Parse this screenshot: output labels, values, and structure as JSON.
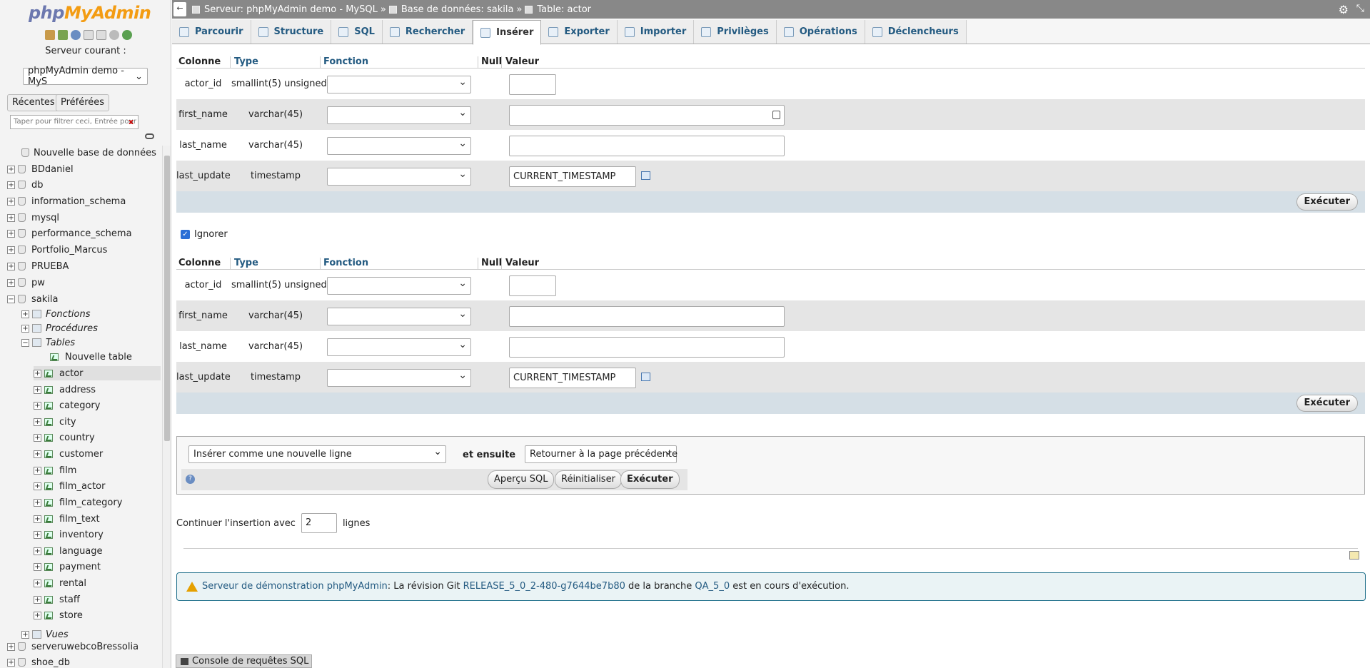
{
  "nav": {
    "logo_php": "php",
    "logo_myadmin": "MyAdmin",
    "server_label": "Serveur courant :",
    "server_select": "phpMyAdmin demo - MyS",
    "recent": "Récentes",
    "favorites": "Préférées",
    "filter_placeholder": "Taper pour filtrer ceci, Entrée pour tout",
    "filter_clear": "x",
    "new_database": "Nouvelle base de données",
    "databases": [
      "BDdaniel",
      "db",
      "information_schema",
      "mysql",
      "performance_schema",
      "Portfolio_Marcus",
      "PRUEBA",
      "pw",
      "sakila"
    ],
    "sakila_groups": {
      "functions": "Fonctions",
      "procedures": "Procédures",
      "tables": "Tables",
      "views": "Vues"
    },
    "new_table": "Nouvelle table",
    "tables": [
      "actor",
      "address",
      "category",
      "city",
      "country",
      "customer",
      "film",
      "film_actor",
      "film_category",
      "film_text",
      "inventory",
      "language",
      "payment",
      "rental",
      "staff",
      "store"
    ],
    "more_databases": [
      "serveruwebcoBressolia",
      "shoe_db"
    ]
  },
  "topbar": {
    "back": "←",
    "server": "Serveur: phpMyAdmin demo - MySQL",
    "sep1": "»",
    "database": "Base de données: sakila",
    "sep2": "»",
    "table": "Table: actor"
  },
  "tabs": [
    {
      "label": "Parcourir"
    },
    {
      "label": "Structure"
    },
    {
      "label": "SQL"
    },
    {
      "label": "Rechercher"
    },
    {
      "label": "Insérer"
    },
    {
      "label": "Exporter"
    },
    {
      "label": "Importer"
    },
    {
      "label": "Privilèges"
    },
    {
      "label": "Opérations"
    },
    {
      "label": "Déclencheurs"
    }
  ],
  "insert": {
    "headers": {
      "column": "Colonne",
      "type": "Type",
      "function": "Fonction",
      "null": "Null",
      "value": "Valeur"
    },
    "rows": [
      {
        "column": "actor_id",
        "type": "smallint(5) unsigned",
        "value": ""
      },
      {
        "column": "first_name",
        "type": "varchar(45)",
        "value": ""
      },
      {
        "column": "last_name",
        "type": "varchar(45)",
        "value": ""
      },
      {
        "column": "last_update",
        "type": "timestamp",
        "value": "CURRENT_TIMESTAMP"
      }
    ],
    "execute": "Exécuter",
    "ignore": "Ignorer"
  },
  "actions": {
    "insert_mode": "Insérer comme une nouvelle ligne",
    "and_then": "et ensuite",
    "after": "Retourner à la page précédente",
    "preview": "Aperçu SQL",
    "reset": "Réinitialiser",
    "execute": "Exécuter",
    "help": "?"
  },
  "continue": {
    "label": "Continuer l'insertion avec",
    "value": "2",
    "suffix": "lignes"
  },
  "notice": {
    "link1": "Serveur de démonstration phpMyAdmin",
    "text1": ": La révision Git ",
    "link2": "RELEASE_5_0_2-480-g7644be7b80",
    "text2": " de la branche ",
    "link3": "QA_5_0",
    "text3": " est en cours d'exécution."
  },
  "console": "Console de requêtes SQL"
}
